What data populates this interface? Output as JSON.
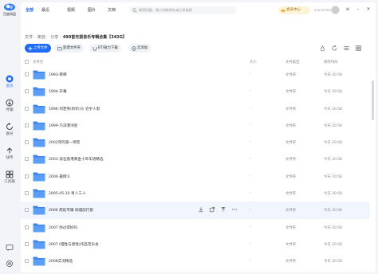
{
  "app": {
    "name": "百度网盘",
    "brand_color": "#1e6bfa"
  },
  "sidebar": {
    "items": [
      {
        "label": "首页",
        "icon": "home-icon",
        "active": true
      },
      {
        "label": "传输",
        "icon": "transfer-icon",
        "active": false
      },
      {
        "label": "备份",
        "icon": "backup-icon",
        "active": false
      },
      {
        "label": "快传",
        "icon": "quick-transfer-icon",
        "active": false
      },
      {
        "label": "工具箱",
        "icon": "toolbox-icon",
        "active": false
      }
    ]
  },
  "topbar": {
    "tabs": [
      {
        "label": "全部",
        "active": true
      },
      {
        "label": "最近",
        "active": false
      },
      {
        "label": "视频",
        "active": false
      },
      {
        "label": "图片",
        "active": false
      },
      {
        "label": "文档",
        "active": false
      }
    ],
    "search_placeholder": "搜索网盘，输入网络地址或分享链接",
    "vip_label": "会员中心",
    "user_text": "478 257597"
  },
  "breadcrumb": {
    "items": [
      "文件",
      "来自：",
      "分享"
    ],
    "current": "490首无损音乐专辑合集【342G】"
  },
  "toolbar": {
    "upload_label": "上传文件",
    "new_folder_label": "新建文件夹",
    "offline_label": "BT/磁力下载",
    "cloud_label": "云添加"
  },
  "table": {
    "headers": {
      "name": "文件名",
      "size": "大小",
      "type": "文件类型",
      "mtime": "修改时间"
    },
    "action_icons": [
      "download-icon",
      "share-icon",
      "pin-icon",
      "more-icon"
    ],
    "rows": [
      {
        "name": "1993-寒蝉",
        "size": "-",
        "type": "文件夹",
        "mtime": "今天 20:58"
      },
      {
        "name": "1994-开幕",
        "size": "-",
        "type": "文件夹",
        "mtime": "今天 20:58"
      },
      {
        "name": "1996-刘若英(聆听)沙 近乎人影",
        "size": "-",
        "type": "文件夹",
        "mtime": "今天 20:58"
      },
      {
        "name": "1999-乃滨港湾星",
        "size": "-",
        "type": "文件夹",
        "mtime": "今天 20:58"
      },
      {
        "name": "2002年的第一场雪",
        "size": "-",
        "type": "文件夹",
        "mtime": "今天 20:58"
      },
      {
        "name": "2003-滚石香港黄金十年华语精选",
        "size": "-",
        "type": "文件夹",
        "mtime": "今天 20:58"
      },
      {
        "name": "2004-最情义",
        "size": "-",
        "type": "文件夹",
        "mtime": "今天 20:58"
      },
      {
        "name": "2005-05-10 男人三十",
        "size": "-",
        "type": "文件夹",
        "mtime": "今天 20:58"
      },
      {
        "name": "2006 周延专辑 倾城前行第",
        "size": "-",
        "type": "文件夹",
        "mtime": "今天 20:58",
        "hover": true
      },
      {
        "name": "2007 你过得好吗",
        "size": "-",
        "type": "文件夹",
        "mtime": "今天 20:58"
      },
      {
        "name": "2007 (理性与感性)作品音乐会",
        "size": "-",
        "type": "文件夹",
        "mtime": "今天 20:58"
      },
      {
        "name": "2008实况精选",
        "size": "-",
        "type": "文件夹",
        "mtime": "今天 20:58"
      },
      {
        "name": "2009念想起前",
        "size": "-",
        "type": "文件夹",
        "mtime": "今天 20:58"
      }
    ]
  },
  "colors": {
    "folder": "#5a9ef7",
    "folder_back": "#3d86ee",
    "hover_row": "#f1f5fe",
    "vip_bg": "#fdf3d9"
  }
}
